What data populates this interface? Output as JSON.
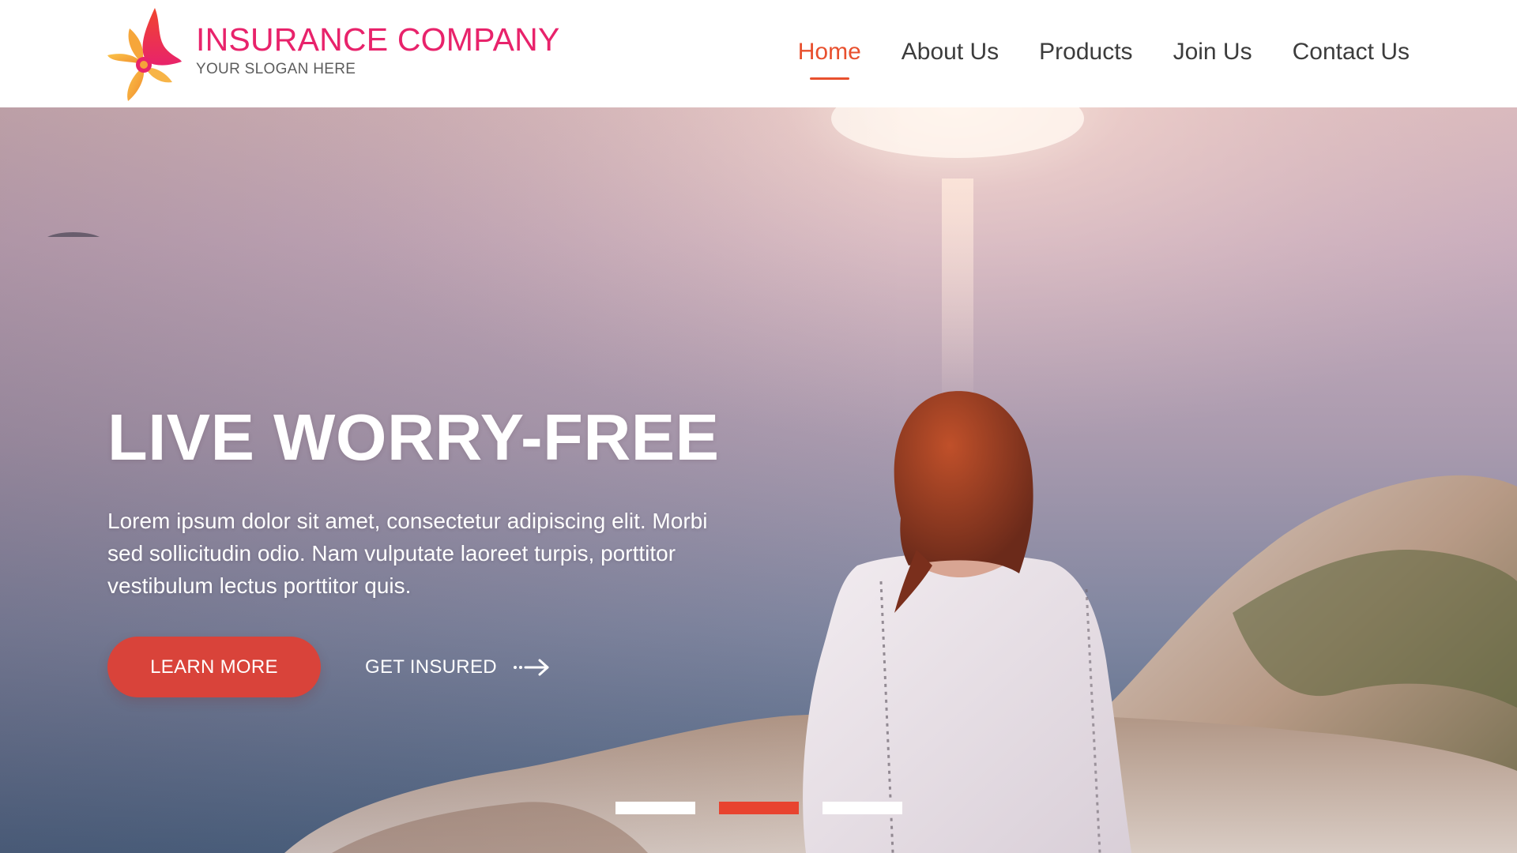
{
  "brand": {
    "name": "INSURANCE COMPANY",
    "slogan": "YOUR SLOGAN HERE",
    "logo_icon": "flame-petal-logo-icon"
  },
  "nav": {
    "items": [
      {
        "label": "Home",
        "active": true
      },
      {
        "label": "About Us",
        "active": false
      },
      {
        "label": "Products",
        "active": false
      },
      {
        "label": "Join Us",
        "active": false
      },
      {
        "label": "Contact Us",
        "active": false
      }
    ]
  },
  "hero": {
    "headline": "LIVE WORRY-FREE",
    "body": "Lorem ipsum dolor sit amet, consectetur adipiscing elit. Morbi sed sollicitudin odio. Nam vulputate laoreet turpis, porttitor vestibulum lectus porttitor quis.",
    "primary_button": "LEARN MORE",
    "secondary_link": "GET INSURED",
    "secondary_icon": "dashed-arrow-right-icon",
    "background_image": "woman-sitting-on-cliff-at-sunset-over-sea"
  },
  "slider": {
    "slide_count": 3,
    "active_index": 1
  },
  "colors": {
    "brand_pink": "#e8236b",
    "accent_orange": "#e8502e",
    "button_red": "#d9433a",
    "indicator_active": "#e8432f",
    "nav_text": "#3c3c3c"
  }
}
